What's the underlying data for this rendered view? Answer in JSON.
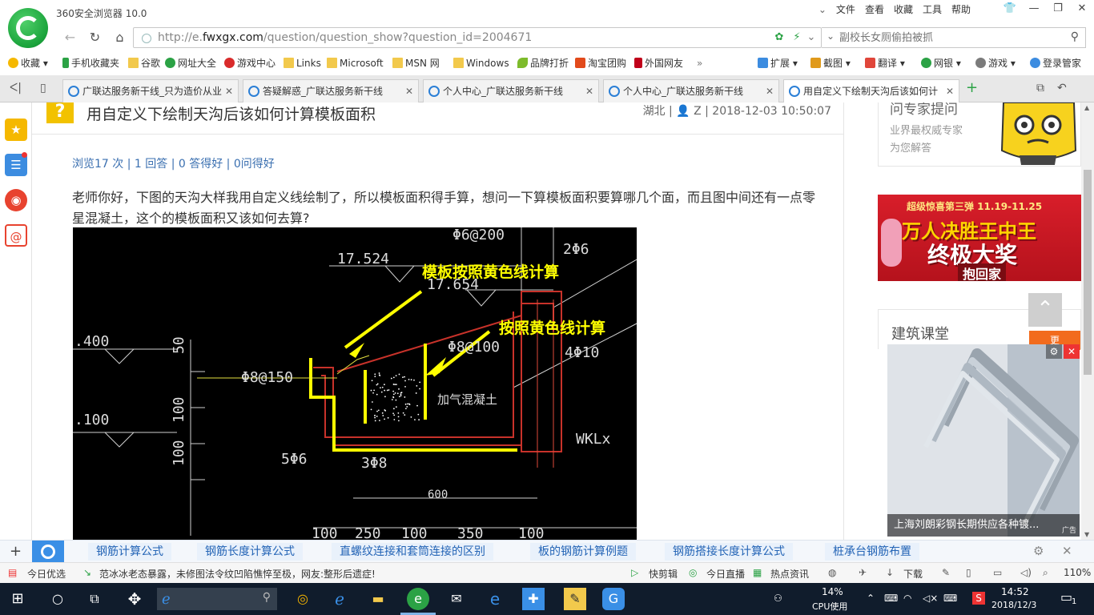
{
  "browser": {
    "title": "360安全浏览器 10.0",
    "menu": [
      "文件",
      "查看",
      "收藏",
      "工具",
      "帮助"
    ],
    "url_prefix": "http://e.",
    "url_domain": "fwxgx.com",
    "url_path": "/question/question_show?question_id=2004671",
    "search_placeholder": "副校长女厕偷拍被抓"
  },
  "bookmarks": [
    {
      "label": "收藏",
      "icon": "star-icon",
      "color": "#f5b800"
    },
    {
      "label": "手机收藏夹",
      "icon": "phone-icon",
      "color": "#2ba245"
    },
    {
      "label": "谷歌",
      "icon": "folder-icon",
      "color": "#f2c94c"
    },
    {
      "label": "网址大全",
      "icon": "globe-icon",
      "color": "#2b7fd6"
    },
    {
      "label": "游戏中心",
      "icon": "game-icon",
      "color": "#d92b2b"
    },
    {
      "label": "Links",
      "icon": "folder-icon",
      "color": "#f2c94c"
    },
    {
      "label": "Microsoft",
      "icon": "folder-icon",
      "color": "#f2c94c"
    },
    {
      "label": "MSN 网",
      "icon": "folder-icon",
      "color": "#f2c94c"
    },
    {
      "label": "Windows",
      "icon": "folder-icon",
      "color": "#f2c94c"
    },
    {
      "label": "品牌打折",
      "icon": "leaf-icon",
      "color": "#7dbb2b"
    },
    {
      "label": "淘宝团购",
      "icon": "taobao-icon",
      "color": "#e24a1b"
    },
    {
      "label": "外国网友",
      "icon": "flag-icon",
      "color": "#c0001a"
    }
  ],
  "bookmark_more": "»",
  "right_tools": [
    "扩展",
    "截图",
    "翻译",
    "网银",
    "游戏",
    "登录管家"
  ],
  "tabs": [
    {
      "label": "广联达服务新干线_只为造价从业"
    },
    {
      "label": "答疑解惑_广联达服务新干线"
    },
    {
      "label": "个人中心_广联达服务新干线"
    },
    {
      "label": "个人中心_广联达服务新干线"
    },
    {
      "label": "用自定义下绘制天沟后该如何计"
    }
  ],
  "question": {
    "title": "用自定义下绘制天沟后该如何计算模板面积",
    "location": "湖北",
    "user": "Z",
    "time": "2018-12-03 10:50:07",
    "stats": "浏览17 次 | 1 回答 | 0 答得好 | 0问得好",
    "body": "老师你好，下图的天沟大样我用自定义线绘制了，所以模板面积得手算，想问一下算模板面积要算哪几个面，而且图中间还有一点零星混凝土，这个的模板面积又该如何去算?"
  },
  "cad": {
    "annot1": "模板按照黄色线计算",
    "annot2": "按照黄色线计算",
    "labels": [
      "Φ6@200",
      "2Φ6",
      "17.524",
      "17.654",
      "Φ8@100",
      "4Φ10",
      "Φ8@150",
      "加气混凝土",
      ".400",
      ".100",
      "50",
      "100",
      "100",
      "5Φ6",
      "3Φ8",
      "WKLx",
      "600",
      "100",
      "250",
      "100",
      "350",
      "100"
    ]
  },
  "sidebar": {
    "expert_title": "问专家提问",
    "expert_line1": "业界最权威专家",
    "expert_line2": "为您解答",
    "ad_top": "超级惊喜第三弹  11.19-11.25",
    "ad_line1": "万人决胜王中王",
    "ad_line2": "终极大奖",
    "ad_line3": "抱回家",
    "course_title": "建筑课堂",
    "course_more": "更"
  },
  "float_ad": {
    "caption": "上海刘朗彩钢长期供应各种镀...",
    "badge": "广告"
  },
  "keywords": [
    "钢筋计算公式",
    "钢筋长度计算公式",
    "直螺纹连接和套筒连接的区别",
    "板的钢筋计算例题",
    "钢筋搭接长度计算公式",
    "桩承台钢筋布置"
  ],
  "status": {
    "today": "今日优选",
    "news": "范冰冰老态暴露，未修图法令纹凹陷憔悴至极，网友:整形后遗症!",
    "items": [
      "快剪辑",
      "今日直播",
      "热点资讯",
      "下载"
    ],
    "zoom": "110%"
  },
  "taskbar": {
    "cpu": "14%",
    "cpu_label": "CPU使用",
    "time": "14:52",
    "date": "2018/12/3",
    "notif": "1"
  }
}
